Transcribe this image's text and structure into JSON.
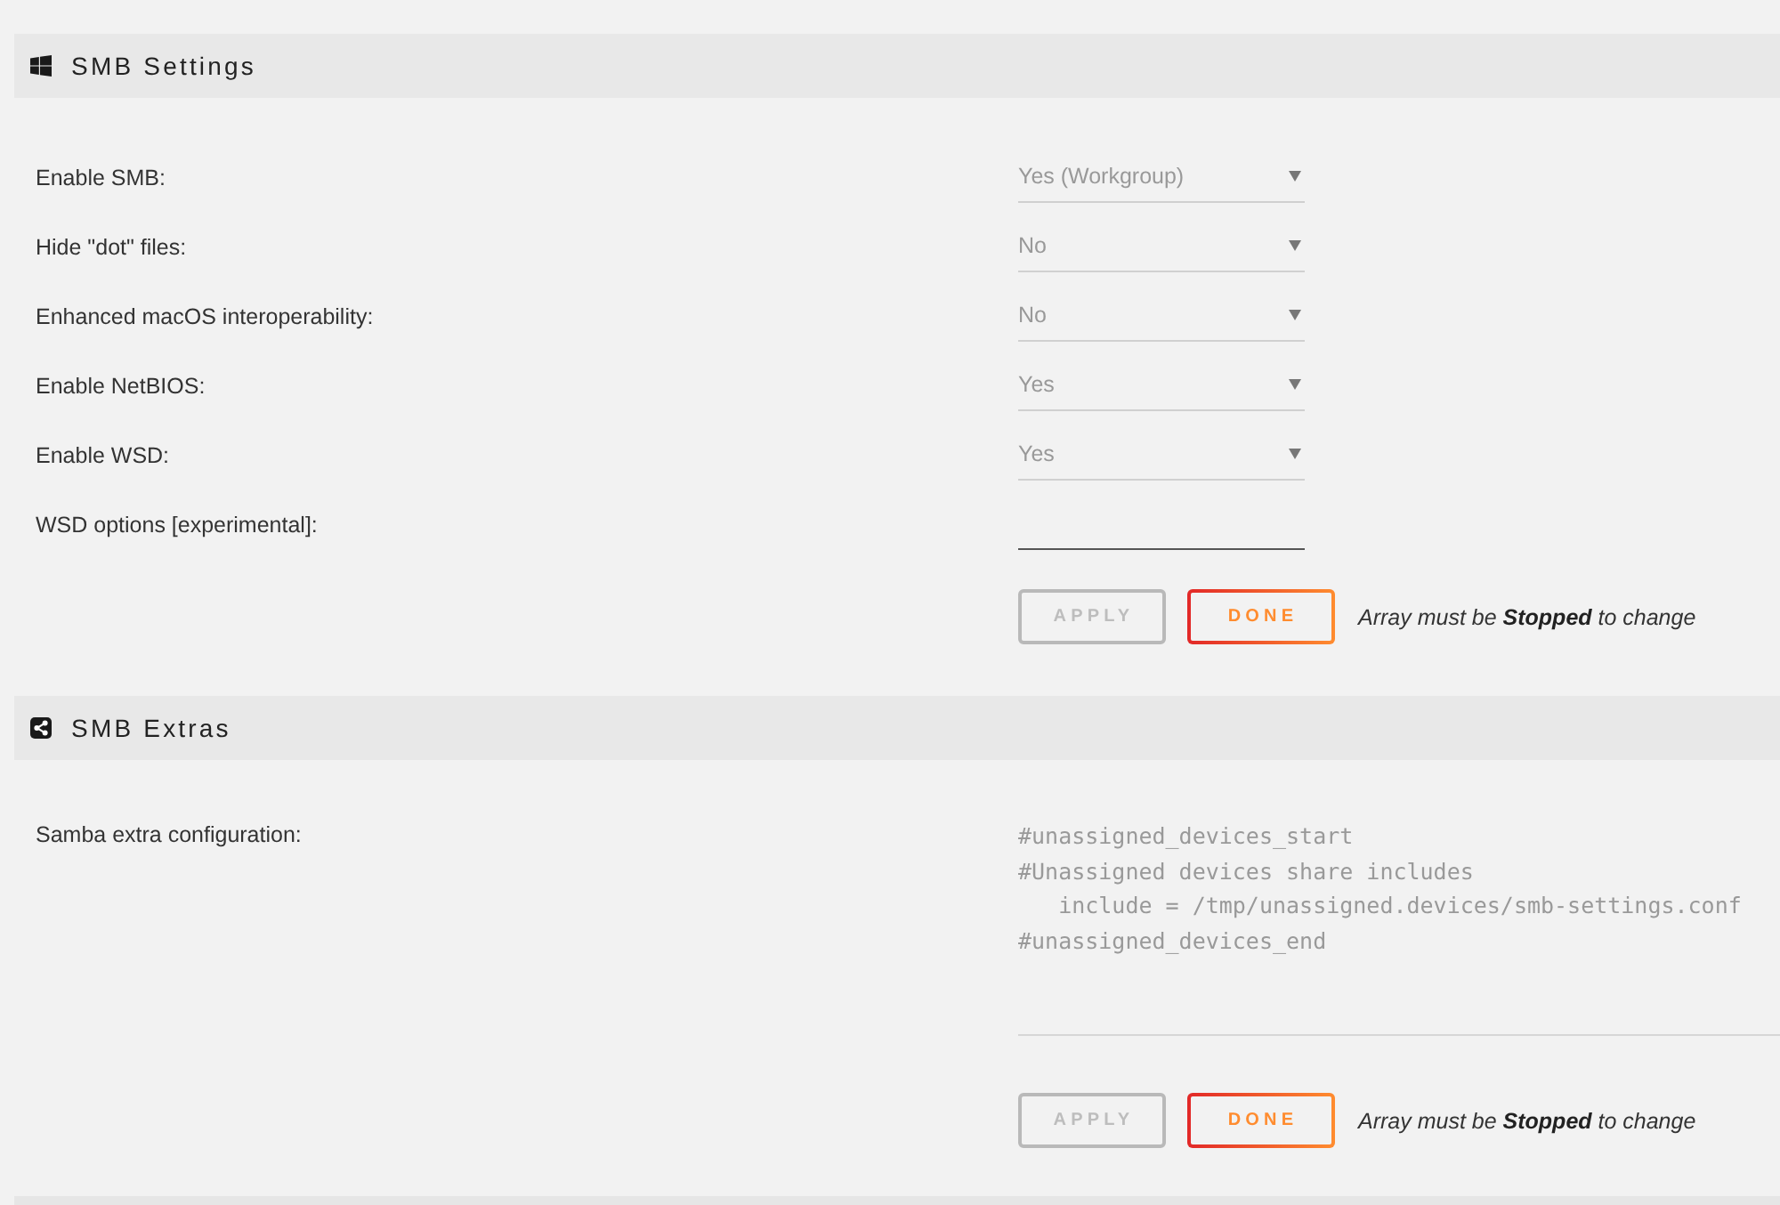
{
  "sections": [
    {
      "title": "SMB Settings",
      "fields": [
        {
          "label": "Enable SMB:",
          "kind": "select",
          "value": "Yes (Workgroup)",
          "disabled": true
        },
        {
          "label": "Hide \"dot\" files:",
          "kind": "select",
          "value": "No",
          "disabled": true
        },
        {
          "label": "Enhanced macOS interoperability:",
          "kind": "select",
          "value": "No",
          "disabled": true
        },
        {
          "label": "Enable NetBIOS:",
          "kind": "select",
          "value": "Yes",
          "disabled": true
        },
        {
          "label": "Enable WSD:",
          "kind": "select",
          "value": "Yes",
          "disabled": true
        },
        {
          "label": "WSD options [experimental]:",
          "kind": "text",
          "disabled": false
        }
      ],
      "buttons": [
        {
          "label": "APPLY",
          "disabled": true
        },
        {
          "label": "DONE",
          "disabled": false
        }
      ],
      "note": "Array must be **Stopped** to change"
    },
    {
      "title": "SMB Extras",
      "fields": [
        {
          "label": "Samba extra configuration:",
          "kind": "textarea",
          "disabled": true,
          "value": "#unassigned_devices_start\n#Unassigned devices share includes\n   include = /tmp/unassigned.devices/smb-settings.conf\n#unassigned_devices_end"
        }
      ],
      "buttons": [
        {
          "label": "APPLY",
          "disabled": true
        },
        {
          "label": "DONE",
          "disabled": false
        }
      ],
      "note": "Array must be **Stopped** to change"
    }
  ]
}
